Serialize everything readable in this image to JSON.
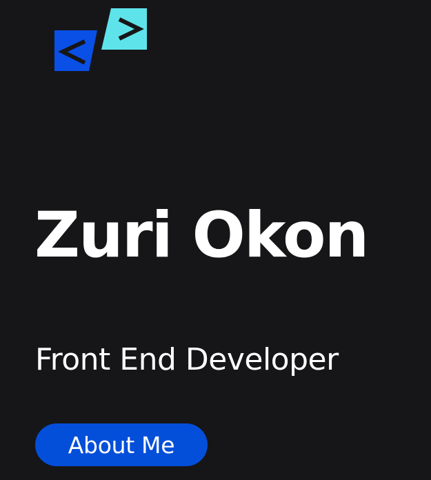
{
  "logo": {
    "icon": "code-brackets-logo-icon",
    "colors": {
      "left_block": "#0a50e6",
      "right_block": "#5fe3ea",
      "glyph": "#161618"
    }
  },
  "hero": {
    "name": "Zuri Okon",
    "role": "Front End Developer",
    "about_label": "About Me"
  },
  "colors": {
    "background": "#161618",
    "text": "#ffffff",
    "accent": "#044fd9"
  }
}
